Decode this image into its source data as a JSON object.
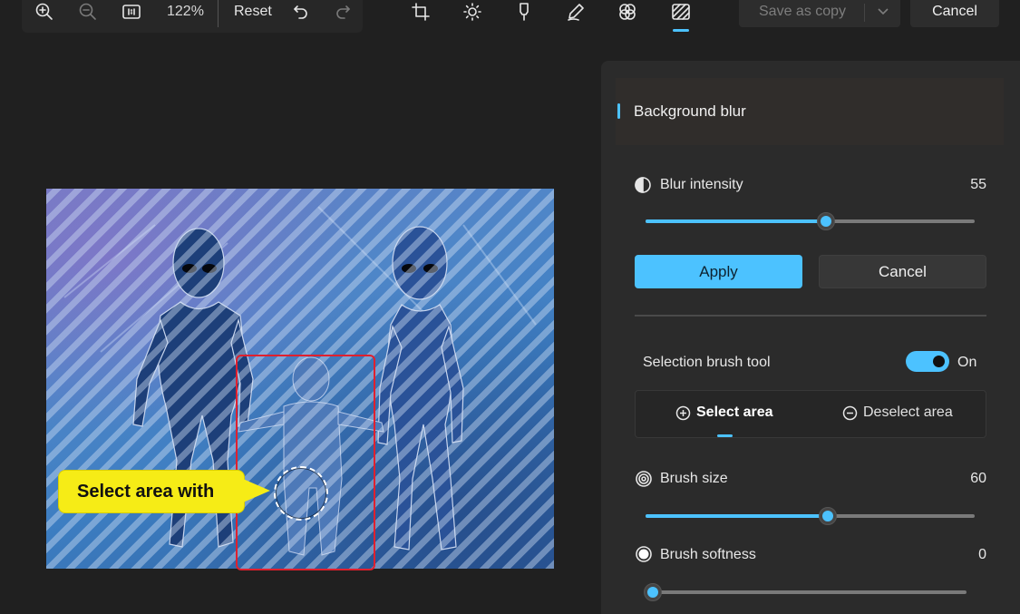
{
  "toolbar": {
    "zoom_level": "122%",
    "reset_label": "Reset",
    "save_label": "Save as copy",
    "cancel_label": "Cancel",
    "icons": [
      "zoom-in-icon",
      "zoom-out-icon",
      "actual-size-icon",
      "undo-icon",
      "redo-icon",
      "crop-icon",
      "brightness-icon",
      "marker-icon",
      "pen-icon",
      "filters-icon",
      "background-blur-icon"
    ],
    "active_tool": "background-blur-icon"
  },
  "canvas": {
    "callout_text": "Select area with"
  },
  "panel": {
    "section_title": "Background blur",
    "blur_intensity": {
      "label": "Blur intensity",
      "value": "55",
      "level": 0.55
    },
    "apply_label": "Apply",
    "cancel_label": "Cancel",
    "selection_brush": {
      "label": "Selection brush tool",
      "state": "On"
    },
    "select_area_label": "Select area",
    "deselect_area_label": "Deselect area",
    "brush_size": {
      "label": "Brush size",
      "value": "60",
      "level": 0.55
    },
    "brush_softness": {
      "label": "Brush softness",
      "value": "0",
      "level": 0.0
    }
  },
  "colors": {
    "accent": "#4cc2ff",
    "background": "#202020",
    "panel": "#2b2b2b",
    "callout": "#f6ec16",
    "selection_box": "#e0202e"
  }
}
